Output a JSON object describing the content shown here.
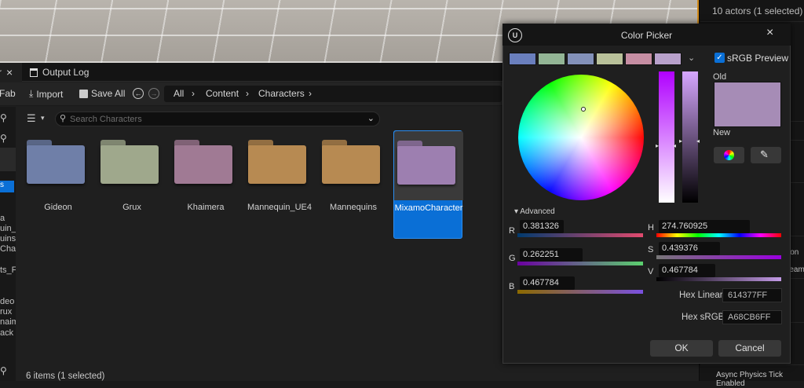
{
  "viewport": {},
  "outliner": {
    "actor_count": "10 actors (1 selected)",
    "tag1": "ion",
    "tag2": "ream",
    "async_label": "Async Physics Tick Enabled"
  },
  "tabs": {
    "content_browser_close": "×",
    "content_browser_partial": "r",
    "output_log": "Output Log"
  },
  "toolbar": {
    "fab_label": "Fab",
    "import_label": "Import",
    "save_all_label": "Save All"
  },
  "breadcrumb": [
    "All",
    "Content",
    "Characters"
  ],
  "search": {
    "placeholder": "Search Characters"
  },
  "sidebar_fragments": [
    "a",
    "uin_U",
    "uins",
    "Char",
    "ts_F",
    "deo",
    "rux",
    "naim",
    "ack"
  ],
  "folders": [
    {
      "name": "Gideon",
      "color": "#6f7fa8",
      "selected": false
    },
    {
      "name": "Grux",
      "color": "#9fa88c",
      "selected": false
    },
    {
      "name": "Khaimera",
      "color": "#a07a94",
      "selected": false
    },
    {
      "name": "Mannequin_UE4",
      "color": "#b78a52",
      "selected": false
    },
    {
      "name": "Mannequins",
      "color": "#b78a52",
      "selected": false
    },
    {
      "name": "MixamoCharacter",
      "color": "#9d7fb0",
      "selected": true
    }
  ],
  "status": "6 items (1 selected)",
  "picker": {
    "title": "Color Picker",
    "logo_text": "U",
    "close_label": "×",
    "recent_colors": [
      "#6a7fbd",
      "#93b595",
      "#8391b9",
      "#b9c19a",
      "#c68ea3",
      "#b8a1cb"
    ],
    "srgb_preview_label": "sRGB Preview",
    "srgb_checked": true,
    "old_label": "Old",
    "new_label": "New",
    "old_color": "#a68cb6",
    "new_color": "#a68cb6",
    "advanced_label": "Advanced",
    "r_letter": "R",
    "g_letter": "G",
    "b_letter": "B",
    "h_letter": "H",
    "s_letter": "S",
    "v_letter": "V",
    "r_value": "0.381326",
    "g_value": "0.262251",
    "b_value": "0.467784",
    "h_value": "274.760925",
    "s_value": "0.439376",
    "v_value": "0.467784",
    "hex_linear_label": "Hex Linear",
    "hex_linear_value": "614377FF",
    "hex_srgb_label": "Hex sRGB",
    "hex_srgb_value": "A68CB6FF",
    "ok_label": "OK",
    "cancel_label": "Cancel"
  }
}
